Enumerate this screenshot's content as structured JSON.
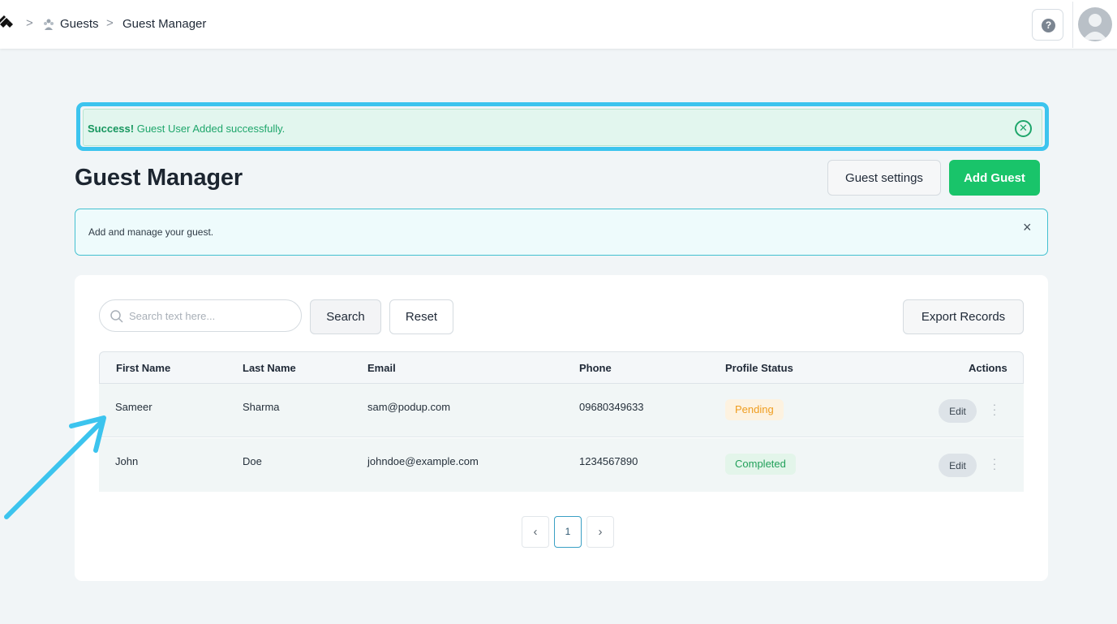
{
  "breadcrumb": {
    "items": [
      "Guests",
      "Guest Manager"
    ],
    "separator": ">"
  },
  "help": {
    "icon": "help-icon",
    "glyph": "?"
  },
  "alert": {
    "bold": "Success!",
    "message": " Guest User Added successfully.",
    "close_icon": "close-circle-icon"
  },
  "page": {
    "title": "Guest Manager"
  },
  "actions": {
    "settings_label": "Guest settings",
    "add_label": "Add Guest"
  },
  "info": {
    "text": "Add and manage your guest.",
    "close_glyph": "×"
  },
  "toolbar": {
    "search_placeholder": "Search text here...",
    "search_value": "",
    "search_label": "Search",
    "reset_label": "Reset",
    "export_label": "Export Records"
  },
  "table": {
    "headers": [
      "First Name",
      "Last Name",
      "Email",
      "Phone",
      "Profile Status",
      "Actions"
    ],
    "rows": [
      {
        "first": "Sameer",
        "last": "Sharma",
        "email": "sam@podup.com",
        "phone": "09680349633",
        "status": "Pending",
        "edit": "Edit"
      },
      {
        "first": "John",
        "last": "Doe",
        "email": "johndoe@example.com",
        "phone": "1234567890",
        "status": "Completed",
        "edit": "Edit"
      }
    ]
  },
  "pagination": {
    "prev": "‹",
    "current": "1",
    "next": "›"
  },
  "colors": {
    "accent": "#19c46a",
    "highlight": "#3cc4ee",
    "pending": "#ef9d1f",
    "completed": "#22a05a"
  }
}
